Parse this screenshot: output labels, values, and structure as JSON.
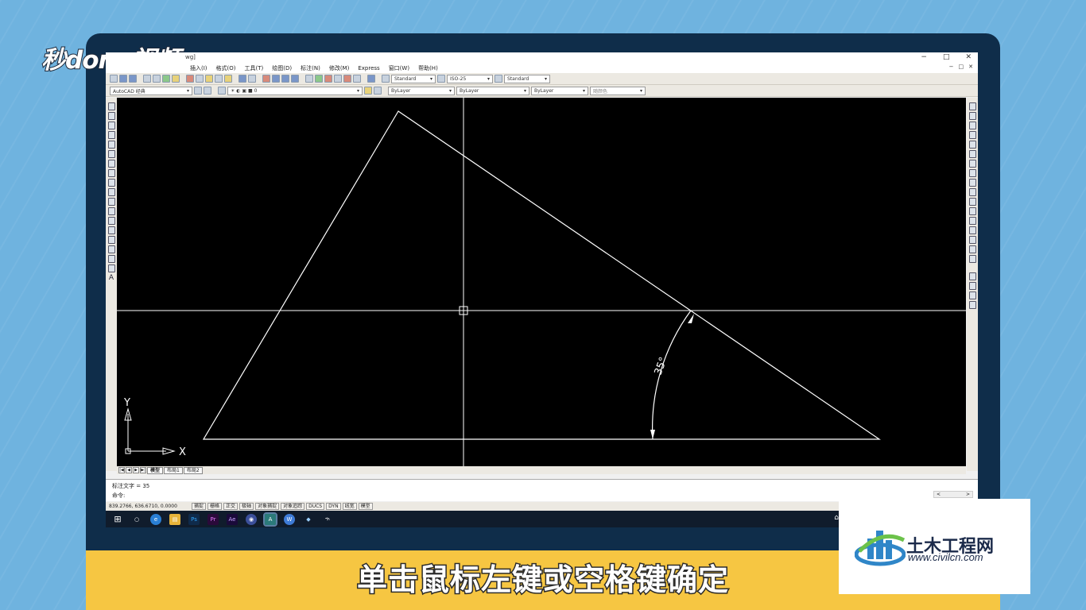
{
  "window": {
    "title_fragment": "wg]",
    "minimize": "−",
    "maximize": "□",
    "close": "✕"
  },
  "menubar": {
    "items": [
      "插入(I)",
      "格式(O)",
      "工具(T)",
      "绘图(D)",
      "标注(N)",
      "修改(M)",
      "Express",
      "窗口(W)",
      "帮助(H)"
    ],
    "doc_controls": [
      "−",
      "□",
      "✕"
    ]
  },
  "toolbar1": {
    "text_style": "Standard",
    "dim_style": "ISO-25",
    "table_style": "Standard"
  },
  "toolbar2": {
    "workspace": "AutoCAD 经典",
    "layer": "0",
    "color": "ByLayer",
    "linetype": "ByLayer",
    "lineweight": "ByLayer",
    "plotstyle": "随颜色"
  },
  "left_tools_last": "A",
  "canvas": {
    "angle_label": "35°",
    "ucs_y": "Y",
    "ucs_x": "X"
  },
  "tabs": {
    "arrows": [
      "|◀",
      "◀",
      "▶",
      "▶|"
    ],
    "items": [
      "模型",
      "布局1",
      "布局2"
    ]
  },
  "command": {
    "line1": "标注文字 = 35",
    "line2": "命令:",
    "scroll_left": "<",
    "scroll_right": ">"
  },
  "statusbar": {
    "coords": "839.2766, 636.6710, 0.0000",
    "buttons": [
      "捕捉",
      "栅格",
      "正交",
      "极轴",
      "对象捕捉",
      "对象追踪",
      "DUCS",
      "DYN",
      "线宽",
      "模型"
    ]
  },
  "taskbar": {
    "apps": [
      {
        "name": "windows-start",
        "label": "⊞"
      },
      {
        "name": "search",
        "label": "○"
      },
      {
        "name": "edge",
        "label": "e"
      },
      {
        "name": "file-explorer",
        "label": "▤"
      },
      {
        "name": "photoshop",
        "label": "Ps"
      },
      {
        "name": "premiere",
        "label": "Pr"
      },
      {
        "name": "after-effects",
        "label": "Ae"
      },
      {
        "name": "browser",
        "label": "◉"
      },
      {
        "name": "autocad",
        "label": "A"
      },
      {
        "name": "app-w",
        "label": "W"
      },
      {
        "name": "app-doc",
        "label": "◆"
      },
      {
        "name": "app-s",
        "label": "ኍ"
      }
    ],
    "tray": "⌂"
  },
  "overlay": {
    "logo": "秒dong视频",
    "subtitle": "单击鼠标左键或空格键确定",
    "watermark_title": "土木工程网",
    "watermark_url": "www.civilcn.com"
  },
  "colors": {
    "background": "#6fb3df",
    "monitor": "#0f2d4a",
    "subtitle_bar": "#f6c642",
    "canvas": "#000000",
    "drawing_lines": "#ffffff"
  }
}
